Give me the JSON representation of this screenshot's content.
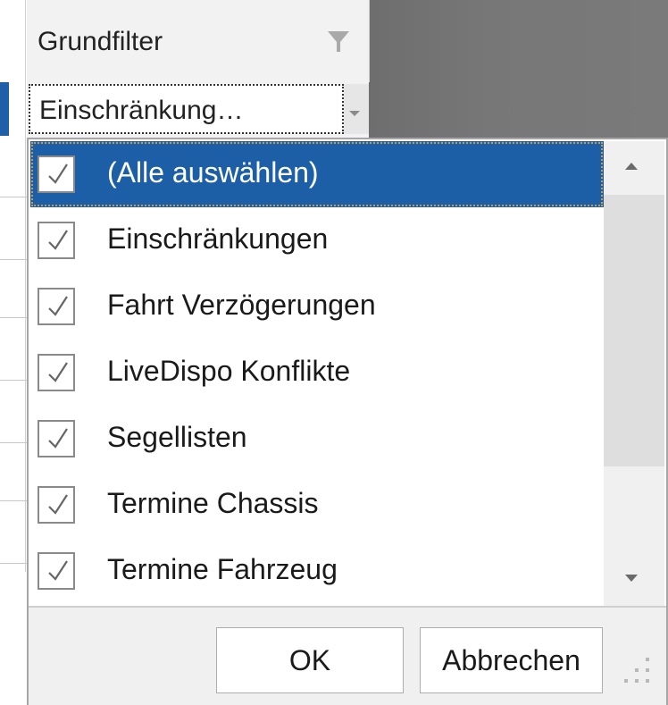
{
  "column_header": {
    "title": "Grundfilter",
    "filter_icon": "funnel-icon"
  },
  "filter_row": {
    "value": "Einschränkung…",
    "dropdown_icon": "chevron-down-icon"
  },
  "popup": {
    "items": [
      {
        "label": "(Alle auswählen)",
        "checked": true,
        "selected": true
      },
      {
        "label": "Einschränkungen",
        "checked": true,
        "selected": false
      },
      {
        "label": "Fahrt Verzögerungen",
        "checked": true,
        "selected": false
      },
      {
        "label": "LiveDispo Konflikte",
        "checked": true,
        "selected": false
      },
      {
        "label": "Segellisten",
        "checked": true,
        "selected": false
      },
      {
        "label": "Termine Chassis",
        "checked": true,
        "selected": false
      },
      {
        "label": "Termine Fahrzeug",
        "checked": true,
        "selected": false
      }
    ],
    "ok_label": "OK",
    "cancel_label": "Abbrechen"
  },
  "colors": {
    "selection": "#1c5fa6",
    "header_bg": "#f2f2f2",
    "dark_area": "#777777"
  }
}
